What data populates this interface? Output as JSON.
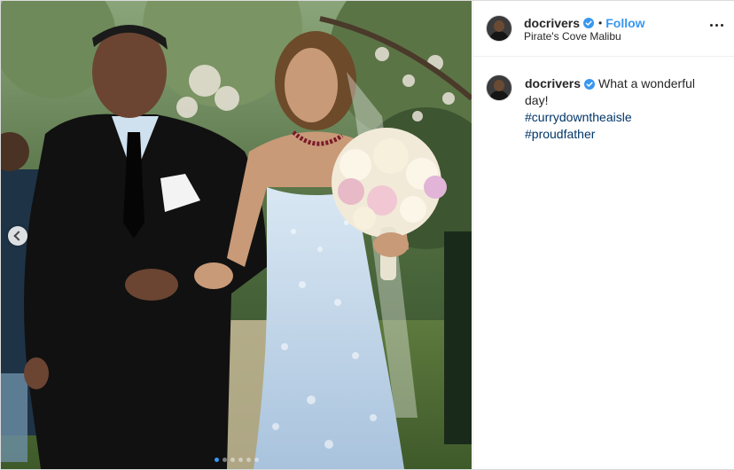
{
  "post": {
    "username": "docrivers",
    "verified": true,
    "follow_label": "Follow",
    "separator": "•",
    "location": "Pirate's Cove Malibu",
    "caption": {
      "username": "docrivers",
      "text": "What a wonderful day!",
      "hashtags": [
        "#currydowntheaisle",
        "#proudfather"
      ]
    },
    "carousel": {
      "slides": 6,
      "active_index": 0
    }
  },
  "colors": {
    "accent": "#3897f0",
    "hashtag": "#003569",
    "text": "#262626",
    "border": "#dbdbdb"
  },
  "icons": {
    "verified": "verified-badge-icon",
    "more": "more-options-icon",
    "prev": "chevron-left-icon"
  }
}
